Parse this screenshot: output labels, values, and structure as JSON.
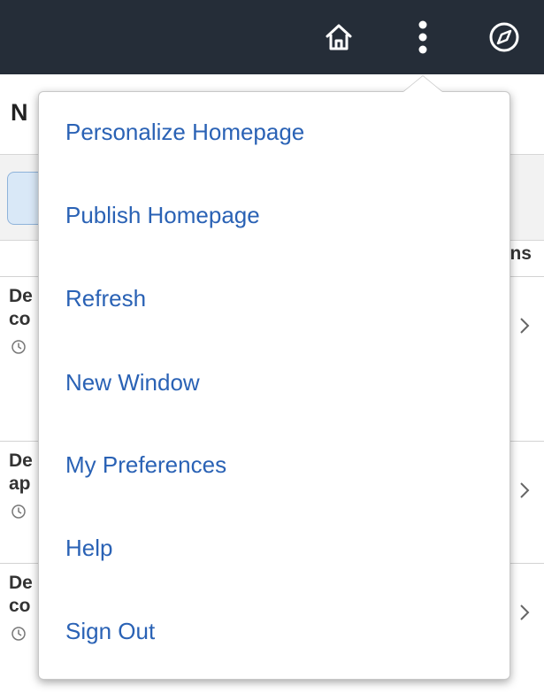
{
  "header": {
    "icons": [
      "home-icon",
      "more-actions-icon",
      "navbar-compass-icon"
    ],
    "bar_color": "#252d38"
  },
  "background": {
    "title_fragment": "N",
    "column_header_fragment": "ns",
    "rows": [
      {
        "line1": "De",
        "line2": "co"
      },
      {
        "line1": "De",
        "line2": "ap"
      },
      {
        "line1": "De",
        "line2": "co"
      }
    ]
  },
  "menu": {
    "accent_color": "#2a62b5",
    "items": [
      {
        "label": "Personalize Homepage"
      },
      {
        "label": "Publish Homepage"
      },
      {
        "label": "Refresh"
      },
      {
        "label": "New Window"
      },
      {
        "label": "My Preferences"
      },
      {
        "label": "Help"
      },
      {
        "label": "Sign Out"
      }
    ]
  }
}
